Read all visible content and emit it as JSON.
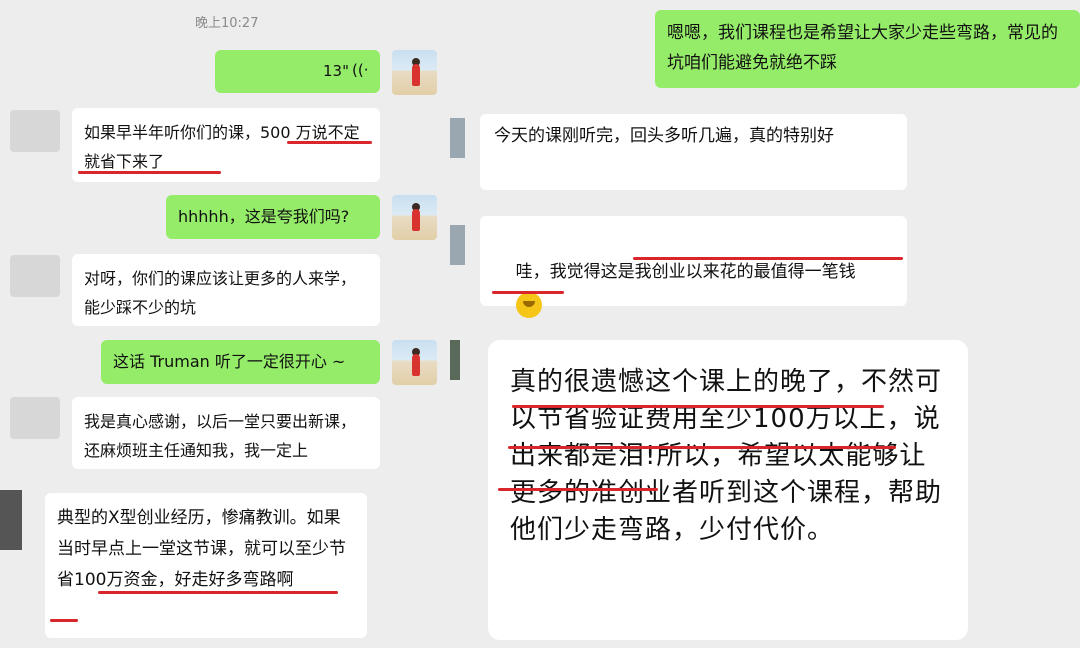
{
  "left": {
    "timestamp": "晚上10:27",
    "voice_duration": "13\"",
    "voice_icon": "voice-wave-icon",
    "messages": [
      "如果早半年听你们的课，500 万说不定就省下来了",
      "hhhhh，这是夸我们吗?",
      "对呀，你们的课应该让更多的人来学，能少踩不少的坑",
      "这话 Truman 听了一定很开心 ~",
      "我是真心感谢，以后一堂只要出新课，还麻烦班主任通知我，我一定上",
      "典型的X型创业经历，惨痛教训。如果当时早点上一堂这节课，就可以至少节省100万资金，好走好多弯路啊"
    ]
  },
  "right": {
    "messages": [
      "嗯嗯，我们课程也是希望让大家少走些弯路，常见的坑咱们能避免就绝不踩",
      "今天的课刚听完，回头多听几遍，真的特别好",
      "哇，我觉得这是我创业以来花的最值得一笔钱",
      "真的很遗憾这个课上的晚了，不然可以节省验证费用至少100万以上，说出来都是泪!所以，希望以太能够让更多的准创业者听到这个课程，帮助他们少走弯路，少付代价。"
    ],
    "emoji_icon": "thinking-face-emoji"
  },
  "colors": {
    "background": "#ededed",
    "bubble_green": "#95ec69",
    "bubble_white": "#ffffff",
    "underline": "#d8262b"
  }
}
